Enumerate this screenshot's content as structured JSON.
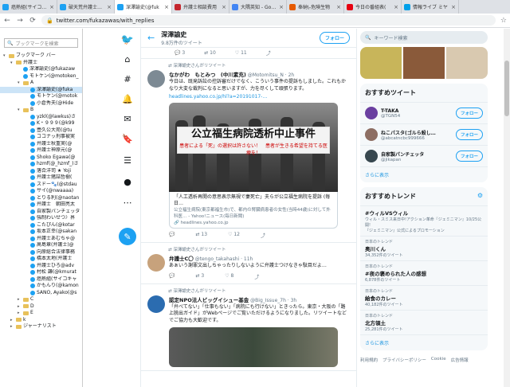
{
  "tabs": [
    {
      "label": "癌熱組(サイコキャ",
      "color": "#1da1f2",
      "active": false
    },
    {
      "label": "破天荒弁護士クロ",
      "color": "#1da1f2",
      "active": false
    },
    {
      "label": "深澤諭史(@fuk",
      "color": "#1da1f2",
      "active": true
    },
    {
      "label": "弁護士相談費用",
      "color": "#c4262e",
      "active": false
    },
    {
      "label": "大隅英知 - Goog",
      "color": "#4285f4",
      "active": false
    },
    {
      "label": "奉納\\-危険生物",
      "color": "#e65a00",
      "active": false
    },
    {
      "label": "今日の番組表(",
      "color": "#e60012",
      "active": false
    },
    {
      "label": "情報ライブ ミヤ",
      "color": "#00a0e9",
      "active": false
    }
  ],
  "url": "twitter.com/fukazawas/with_replies",
  "bookmarks": {
    "search_placeholder": "ブックマークを検索",
    "rows": [
      {
        "type": "folder",
        "indent": 0,
        "exp": "▾",
        "label": "ブックマーク バー",
        "sel": false
      },
      {
        "type": "folder",
        "indent": 1,
        "exp": "▾",
        "label": "弁護士",
        "sel": false
      },
      {
        "type": "tw",
        "indent": 2,
        "exp": "",
        "label": "深澤諭史(@fukazaw",
        "sel": false
      },
      {
        "type": "tw",
        "indent": 2,
        "exp": "",
        "label": "モトケン(@motoken_",
        "sel": false
      },
      {
        "type": "folder",
        "indent": 2,
        "exp": "▾",
        "label": "A",
        "sel": false
      },
      {
        "type": "tw",
        "indent": 3,
        "exp": "",
        "label": "深澤諭史(@fuka",
        "sel": true
      },
      {
        "type": "tw",
        "indent": 3,
        "exp": "",
        "label": "モトケン(@motok",
        "sel": false
      },
      {
        "type": "tw",
        "indent": 3,
        "exp": "",
        "label": "小倉秀夫(@Hide",
        "sel": false
      },
      {
        "type": "folder",
        "indent": 2,
        "exp": "▾",
        "label": "B",
        "sel": false
      },
      {
        "type": "tw",
        "indent": 3,
        "exp": "",
        "label": "yzkl(@lawkus)さ",
        "sel": false
      },
      {
        "type": "tw",
        "indent": 3,
        "exp": "",
        "label": "K・９９９(@k99",
        "sel": false
      },
      {
        "type": "tw",
        "indent": 3,
        "exp": "",
        "label": "壺久公大苑(@tu",
        "sel": false
      },
      {
        "type": "tw",
        "indent": 3,
        "exp": "",
        "label": "ココナッ刑事被実",
        "sel": false
      },
      {
        "type": "tw",
        "indent": 3,
        "exp": "",
        "label": "弁護士秋重実(@",
        "sel": false
      },
      {
        "type": "tw",
        "indent": 3,
        "exp": "",
        "label": "弁護士神原元(@",
        "sel": false
      },
      {
        "type": "tw",
        "indent": 3,
        "exp": "",
        "label": "Shoko Egawa(@",
        "sel": false
      },
      {
        "type": "tw",
        "indent": 3,
        "exp": "",
        "label": "hzmf(@_hzmf_)さ",
        "sel": false
      },
      {
        "type": "tw",
        "indent": 3,
        "exp": "",
        "label": "落合洋司 ★ Yoji",
        "sel": false
      },
      {
        "type": "tw",
        "indent": 3,
        "exp": "",
        "label": "弁護士猪詰哲樹(",
        "sel": false
      },
      {
        "type": "tw",
        "indent": 3,
        "exp": "",
        "label": "スドー🐾(@stdau",
        "sel": false
      },
      {
        "type": "tw",
        "indent": 3,
        "exp": "",
        "label": "サイ(@nwaaaa)",
        "sel": false
      },
      {
        "type": "tw",
        "indent": 3,
        "exp": "",
        "label": "とりる利(@naotan",
        "sel": false
      },
      {
        "type": "tw",
        "indent": 3,
        "exp": "",
        "label": "弁護士　朝田亮太",
        "sel": false
      },
      {
        "type": "tw",
        "indent": 3,
        "exp": "",
        "label": "自家製パンチェッタ",
        "sel": false
      },
      {
        "type": "tw",
        "indent": 3,
        "exp": "",
        "label": "強制わいせつ〉界",
        "sel": false
      },
      {
        "type": "tw",
        "indent": 3,
        "exp": "",
        "label": "こたぴん(@kotar",
        "sel": false
      },
      {
        "type": "tw",
        "indent": 3,
        "exp": "",
        "label": "坂本正幸(@sakan",
        "sel": false
      },
      {
        "type": "tw",
        "indent": 3,
        "exp": "",
        "label": "弁護士あむちゃ@",
        "sel": false
      },
      {
        "type": "tw",
        "indent": 3,
        "exp": "",
        "label": "高島章(弁護士)@",
        "sel": false
      },
      {
        "type": "tw",
        "indent": 3,
        "exp": "",
        "label": "向原総合法律事務",
        "sel": false
      },
      {
        "type": "tw",
        "indent": 3,
        "exp": "",
        "label": "橋本太地(弁護士",
        "sel": false
      },
      {
        "type": "tw",
        "indent": 3,
        "exp": "",
        "label": "弁護士ひろ@adv",
        "sel": false
      },
      {
        "type": "tw",
        "indent": 3,
        "exp": "",
        "label": "村松 謙(@kmurat",
        "sel": false
      },
      {
        "type": "tw",
        "indent": 3,
        "exp": "",
        "label": "癌熱組(サイコキャ",
        "sel": false
      },
      {
        "type": "tw",
        "indent": 3,
        "exp": "",
        "label": "かもんり(@kamon",
        "sel": false
      },
      {
        "type": "tw",
        "indent": 3,
        "exp": "",
        "label": "SANO, Ayako(@s",
        "sel": false
      },
      {
        "type": "folder",
        "indent": 2,
        "exp": "▸",
        "label": "C",
        "sel": false
      },
      {
        "type": "folder",
        "indent": 2,
        "exp": "▸",
        "label": "D",
        "sel": false
      },
      {
        "type": "folder",
        "indent": 2,
        "exp": "▸",
        "label": "E",
        "sel": false
      },
      {
        "type": "folder",
        "indent": 1,
        "exp": "▸",
        "label": "k",
        "sel": false
      },
      {
        "type": "folder",
        "indent": 1,
        "exp": "▸",
        "label": "ジャーナリスト",
        "sel": false
      }
    ]
  },
  "nav_icons": [
    "twitter-bird-icon",
    "explore-icon",
    "hashtag-icon",
    "notifications-icon",
    "messages-icon",
    "bookmarks-icon",
    "lists-icon",
    "profile-icon",
    "more-icon"
  ],
  "nav_glyphs": [
    "🐦",
    "⌂",
    "#",
    "🔔",
    "✉",
    "🔖",
    "☰",
    "●",
    "⋯"
  ],
  "profile": {
    "name": "深澤諭史",
    "tweets": "9.8万件のツイート",
    "follow": "フォロー"
  },
  "top_actions": {
    "reply": "3",
    "retweet": "10",
    "like": "11"
  },
  "tweets": [
    {
      "rt_by": "深澤諭史さんがリツイート",
      "name": "なかがわ　もとみつ　(中川素充)",
      "handle": "@Motomitsu_N · 2h",
      "text": "今日は、既発訴訟の控訴審だけでなく、こういう事件の提訴もしました。これもかなり大変な裁判になると思いますが、力を尽くして頑張ります。",
      "link": "headlines.yahoo.co.jp/hl?a=20191017-…",
      "photo": {
        "main": "公立福生病院透析中止事件",
        "sub": "患者による「死」の選択は許さない！　患者が生きる希望を持てる医療を！"
      },
      "card": {
        "title": "「人工透析再開の意思表示無視で妻死亡」夫らが公立福生病院を提訴 (毎日…",
        "desc": "公立福生病院(東京都福生市)で、都内の腎臓病患者の女性(当時44歳)に対して外科医… - Yahoo!ニュース(毎日新聞)",
        "domain": "headlines.yahoo.co.jp"
      },
      "actions": {
        "reply": "",
        "retweet": "13",
        "like": "12"
      }
    },
    {
      "rt_by": "深澤諭史さんがリツイート",
      "name": "弁護士C〇",
      "handle": "@tengo_takahashi · 11h",
      "text": "あぁいう謝罪文出しちゃったりしないように弁護士つけなきゃ駄目だよ…",
      "actions": {
        "reply": "",
        "retweet": "3",
        "like": "8"
      }
    },
    {
      "rt_by": "深澤諭史さんがリツイート",
      "name": "認定NPO法人ビッグイシュー基金",
      "handle": "@Big_Issue_7h · 3h",
      "text": "「弁べてない」「仕事もない」「病院にも行けない」ときったら。東京・大阪の「路上脱出ガイド」がWebページでご覧いただけるようになりました。リツイートなどでご協力も大歓迎です。"
    }
  ],
  "right": {
    "search_placeholder": "キーワード検索",
    "recommend_title": "おすすめツイート",
    "recommendations": [
      {
        "name": "T-TAKA",
        "handle": "@TGN54",
        "color": "#6a3fa0",
        "follow": "フォロー"
      },
      {
        "name": "ねこパスタ(ゴルら殺し…",
        "handle": "@abcatncbc999666",
        "color": "#8d6e63",
        "follow": "フォロー"
      },
      {
        "name": "自家製パンチェッタ",
        "handle": "@jikapan",
        "color": "#37474f",
        "follow": "フォロー"
      }
    ],
    "more1": "さらに表示",
    "trends_title": "おすすめトレンド",
    "trends": [
      {
        "ctx": "",
        "name": "#ウィルVSウィル",
        "count": "",
        "promo": "ウィル・スミス来日中!アクション革命『ジェミニマン』10/25公開!",
        "promo2": "『ジェミニマン』公式によるプロモーション"
      },
      {
        "ctx": "日本のトレンド",
        "name": "奥川くん",
        "count": "34,352件のツイート",
        "promo": "",
        "promo2": ""
      },
      {
        "ctx": "日本のトレンド",
        "name": "#夜の褒められた人の感想",
        "count": "6,878件のツイート",
        "promo": "",
        "promo2": ""
      },
      {
        "ctx": "日本のトレンド",
        "name": "給食のカレー",
        "count": "40,182件のツイート",
        "promo": "",
        "promo2": ""
      },
      {
        "ctx": "日本のトレンド",
        "name": "北方領土",
        "count": "25,281件のツイート",
        "promo": "",
        "promo2": ""
      }
    ],
    "more2": "さらに表示",
    "footer": [
      "利用規約",
      "プライバシーポリシー",
      "Cookie",
      "広告情報"
    ]
  }
}
